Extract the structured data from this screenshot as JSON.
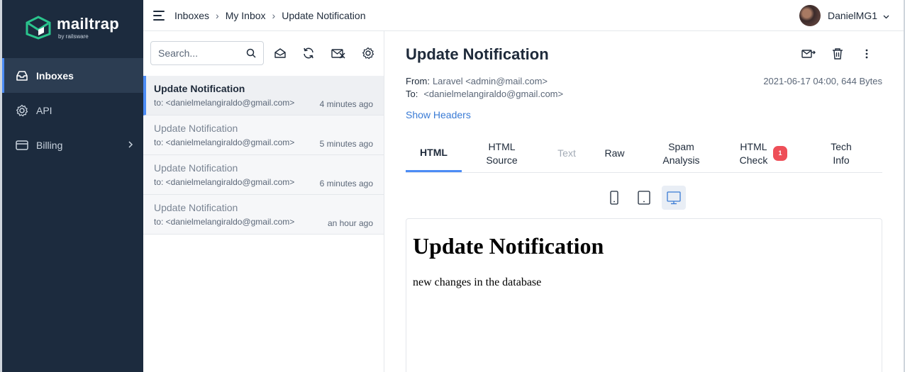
{
  "brand": {
    "name": "mailtrap",
    "sub": "by railsware",
    "accent": "#2ac48d"
  },
  "sidebar": {
    "items": [
      {
        "label": "Inboxes",
        "icon": "inbox-icon"
      },
      {
        "label": "API",
        "icon": "gear-icon"
      },
      {
        "label": "Billing",
        "icon": "credit-card-icon"
      }
    ]
  },
  "topbar": {
    "breadcrumb": [
      "Inboxes",
      "My Inbox",
      "Update Notification"
    ],
    "user": "DanielMG1"
  },
  "list": {
    "search_placeholder": "Search...",
    "messages": [
      {
        "subject": "Update Notification",
        "to": "to: <danielmelangiraldo@gmail.com>",
        "time": "4 minutes ago"
      },
      {
        "subject": "Update Notification",
        "to": "to: <danielmelangiraldo@gmail.com>",
        "time": "5 minutes ago"
      },
      {
        "subject": "Update Notification",
        "to": "to: <danielmelangiraldo@gmail.com>",
        "time": "6 minutes ago"
      },
      {
        "subject": "Update Notification",
        "to": "to: <danielmelangiraldo@gmail.com>",
        "time": "an hour ago"
      }
    ]
  },
  "detail": {
    "title": "Update Notification",
    "from_label": "From:",
    "from": "Laravel <admin@mail.com>",
    "to_label": "To:",
    "to": "<danielmelangiraldo@gmail.com>",
    "date_size": "2021-06-17 04:00, 644 Bytes",
    "show_headers": "Show Headers",
    "tabs": [
      {
        "label": "HTML",
        "state": "active"
      },
      {
        "label": "HTML Source",
        "state": "normal"
      },
      {
        "label": "Text",
        "state": "disabled"
      },
      {
        "label": "Raw",
        "state": "normal"
      },
      {
        "label": "Spam Analysis",
        "state": "normal"
      },
      {
        "label": "HTML Check",
        "state": "normal",
        "badge": "1"
      },
      {
        "label": "Tech Info",
        "state": "normal"
      }
    ],
    "preview": {
      "heading": "Update Notification",
      "body": "new changes in the database"
    }
  }
}
